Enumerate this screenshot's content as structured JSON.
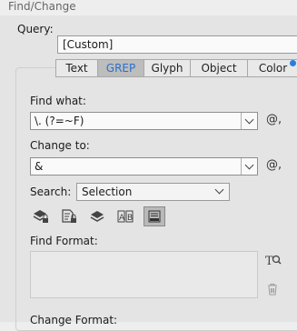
{
  "window": {
    "title": "Find/Change"
  },
  "query": {
    "label": "Query:",
    "value": "[Custom]"
  },
  "tabs": [
    {
      "label": "Text",
      "active": false
    },
    {
      "label": "GREP",
      "active": true
    },
    {
      "label": "Glyph",
      "active": false
    },
    {
      "label": "Object",
      "active": false
    },
    {
      "label": "Color",
      "active": false
    }
  ],
  "find": {
    "label": "Find what:",
    "value": "\\. (?=~F)"
  },
  "change": {
    "label": "Change to:",
    "value": "&"
  },
  "search": {
    "label": "Search:",
    "value": "Selection"
  },
  "options": [
    {
      "icon": "include-locked-layers-icon",
      "active": false
    },
    {
      "icon": "include-locked-stories-icon",
      "active": false
    },
    {
      "icon": "include-hidden-layers-icon",
      "active": false
    },
    {
      "icon": "include-master-pages-icon",
      "active": false
    },
    {
      "icon": "include-footnotes-icon",
      "active": true
    }
  ],
  "find_format": {
    "label": "Find Format:"
  },
  "change_format": {
    "label": "Change Format:"
  },
  "colors": {
    "accent": "#2a6fd0",
    "dot": "#2b7de0"
  }
}
